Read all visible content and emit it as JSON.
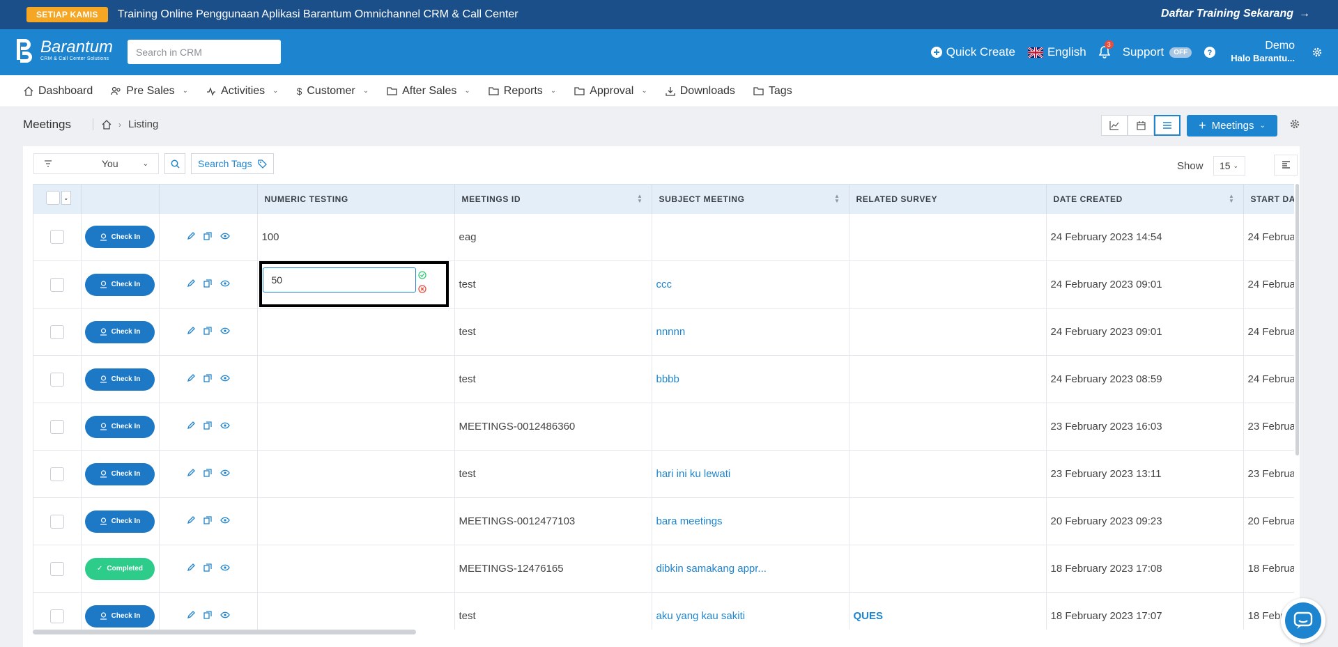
{
  "promo": {
    "badge": "SETIAP KAMIS",
    "text": "Training Online Penggunaan Aplikasi Barantum Omnichannel CRM & Call Center",
    "cta": "Daftar Training Sekarang"
  },
  "header": {
    "logo_name": "Barantum",
    "logo_sub": "CRM & Call Center Solutions",
    "search_placeholder": "Search in CRM",
    "quick_create": "Quick Create",
    "language": "English",
    "notif_count": "3",
    "support": "Support",
    "support_state": "OFF",
    "user_name": "Demo",
    "user_greeting": "Halo Barantu..."
  },
  "nav": {
    "dashboard": "Dashboard",
    "pre_sales": "Pre Sales",
    "activities": "Activities",
    "customer": "Customer",
    "after_sales": "After Sales",
    "reports": "Reports",
    "approval": "Approval",
    "downloads": "Downloads",
    "tags": "Tags"
  },
  "page": {
    "title": "Meetings",
    "crumb": "Listing",
    "create_button": "Meetings"
  },
  "filters": {
    "owner": "You",
    "search_tags": "Search Tags",
    "show_label": "Show",
    "page_size": "15"
  },
  "table": {
    "columns": {
      "numeric_testing": "NUMERIC TESTING",
      "meetings_id": "MEETINGS ID",
      "subject_meeting": "SUBJECT MEETING",
      "related_survey": "RELATED SURVEY",
      "date_created": "DATE CREATED",
      "start_date": "START DA"
    },
    "editing_value": "50",
    "rows": [
      {
        "action": "Check In",
        "numeric": "100",
        "meetings_id": "eag",
        "subject": "",
        "survey": "",
        "date_created": "24 February 2023 14:54",
        "start": "24 Februa"
      },
      {
        "action": "Check In",
        "numeric": "",
        "meetings_id": "test",
        "subject": "ccc",
        "survey": "",
        "date_created": "24 February 2023 09:01",
        "start": "24 Februa"
      },
      {
        "action": "Check In",
        "numeric": "",
        "meetings_id": "test",
        "subject": "nnnnn",
        "survey": "",
        "date_created": "24 February 2023 09:01",
        "start": "24 Februa"
      },
      {
        "action": "Check In",
        "numeric": "",
        "meetings_id": "test",
        "subject": "bbbb",
        "survey": "",
        "date_created": "24 February 2023 08:59",
        "start": "24 Februa"
      },
      {
        "action": "Check In",
        "numeric": "",
        "meetings_id": "MEETINGS-0012486360",
        "subject": "",
        "survey": "",
        "date_created": "23 February 2023 16:03",
        "start": "23 Februa"
      },
      {
        "action": "Check In",
        "numeric": "",
        "meetings_id": "test",
        "subject": "hari ini ku lewati",
        "survey": "",
        "date_created": "23 February 2023 13:11",
        "start": "23 Februa"
      },
      {
        "action": "Check In",
        "numeric": "",
        "meetings_id": "MEETINGS-0012477103",
        "subject": "bara meetings",
        "survey": "",
        "date_created": "20 February 2023 09:23",
        "start": "20 Februa"
      },
      {
        "action": "Completed",
        "numeric": "",
        "meetings_id": "MEETINGS-12476165",
        "subject": "dibkin samakang appr...",
        "survey": "",
        "date_created": "18 February 2023 17:08",
        "start": "18 Februa"
      },
      {
        "action": "Check In",
        "numeric": "",
        "meetings_id": "test",
        "subject": "aku yang kau sakiti",
        "survey": "QUES",
        "date_created": "18 February 2023 17:07",
        "start": "18 Febr"
      }
    ]
  },
  "colors": {
    "primary": "#1d84cf",
    "promo_bg": "#1b4f8a",
    "badge": "#f5a623",
    "completed": "#2ecc8a"
  }
}
